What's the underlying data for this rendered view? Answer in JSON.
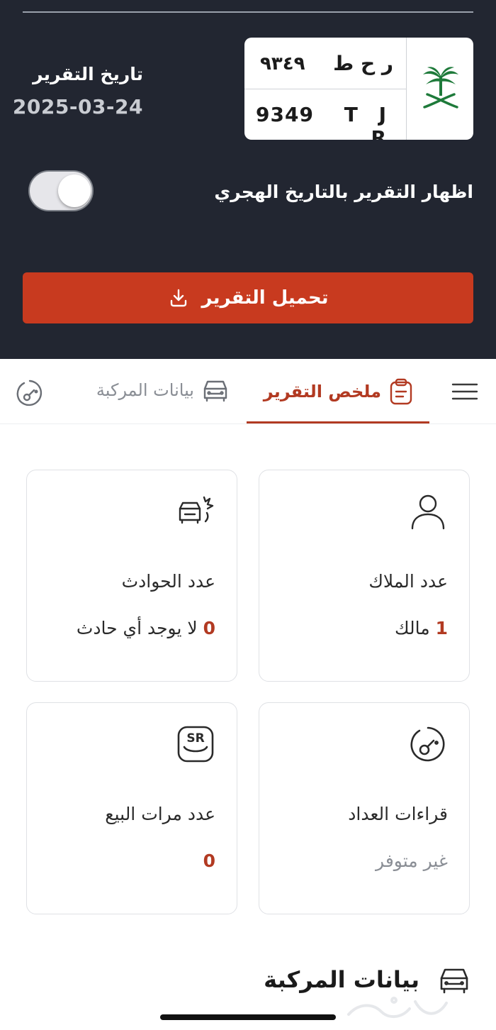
{
  "plate": {
    "arabic_number": "٩٣٤٩",
    "arabic_letters": "ر ح ط",
    "english_number": "9349",
    "english_letters": "T J R"
  },
  "report": {
    "date_label": "تاريخ التقرير",
    "date_value": "2025-03-24",
    "hijri_toggle_label": "اظهار التقرير بالتاريخ الهجري",
    "hijri_toggle_on": false,
    "download_label": "تحميل التقرير"
  },
  "tabs": [
    {
      "label": "ملخص التقرير",
      "active": true
    },
    {
      "label": "بيانات المركبة",
      "active": false
    }
  ],
  "cards": {
    "owners": {
      "title": "عدد الملاك",
      "value_num": "1",
      "value_text": "مالك"
    },
    "accidents": {
      "title": "عدد الحوادث",
      "value_num": "0",
      "value_text": "لا يوجد أي حادث"
    },
    "odometer": {
      "title": "قراءات العداد",
      "value_text": "غير متوفر"
    },
    "sales": {
      "title": "عدد مرات البيع",
      "value_num": "0"
    }
  },
  "section": {
    "title": "بيانات المركبة"
  },
  "colors": {
    "header_bg": "#222631",
    "accent": "#c83a1f",
    "accent_text": "#b23a22"
  }
}
